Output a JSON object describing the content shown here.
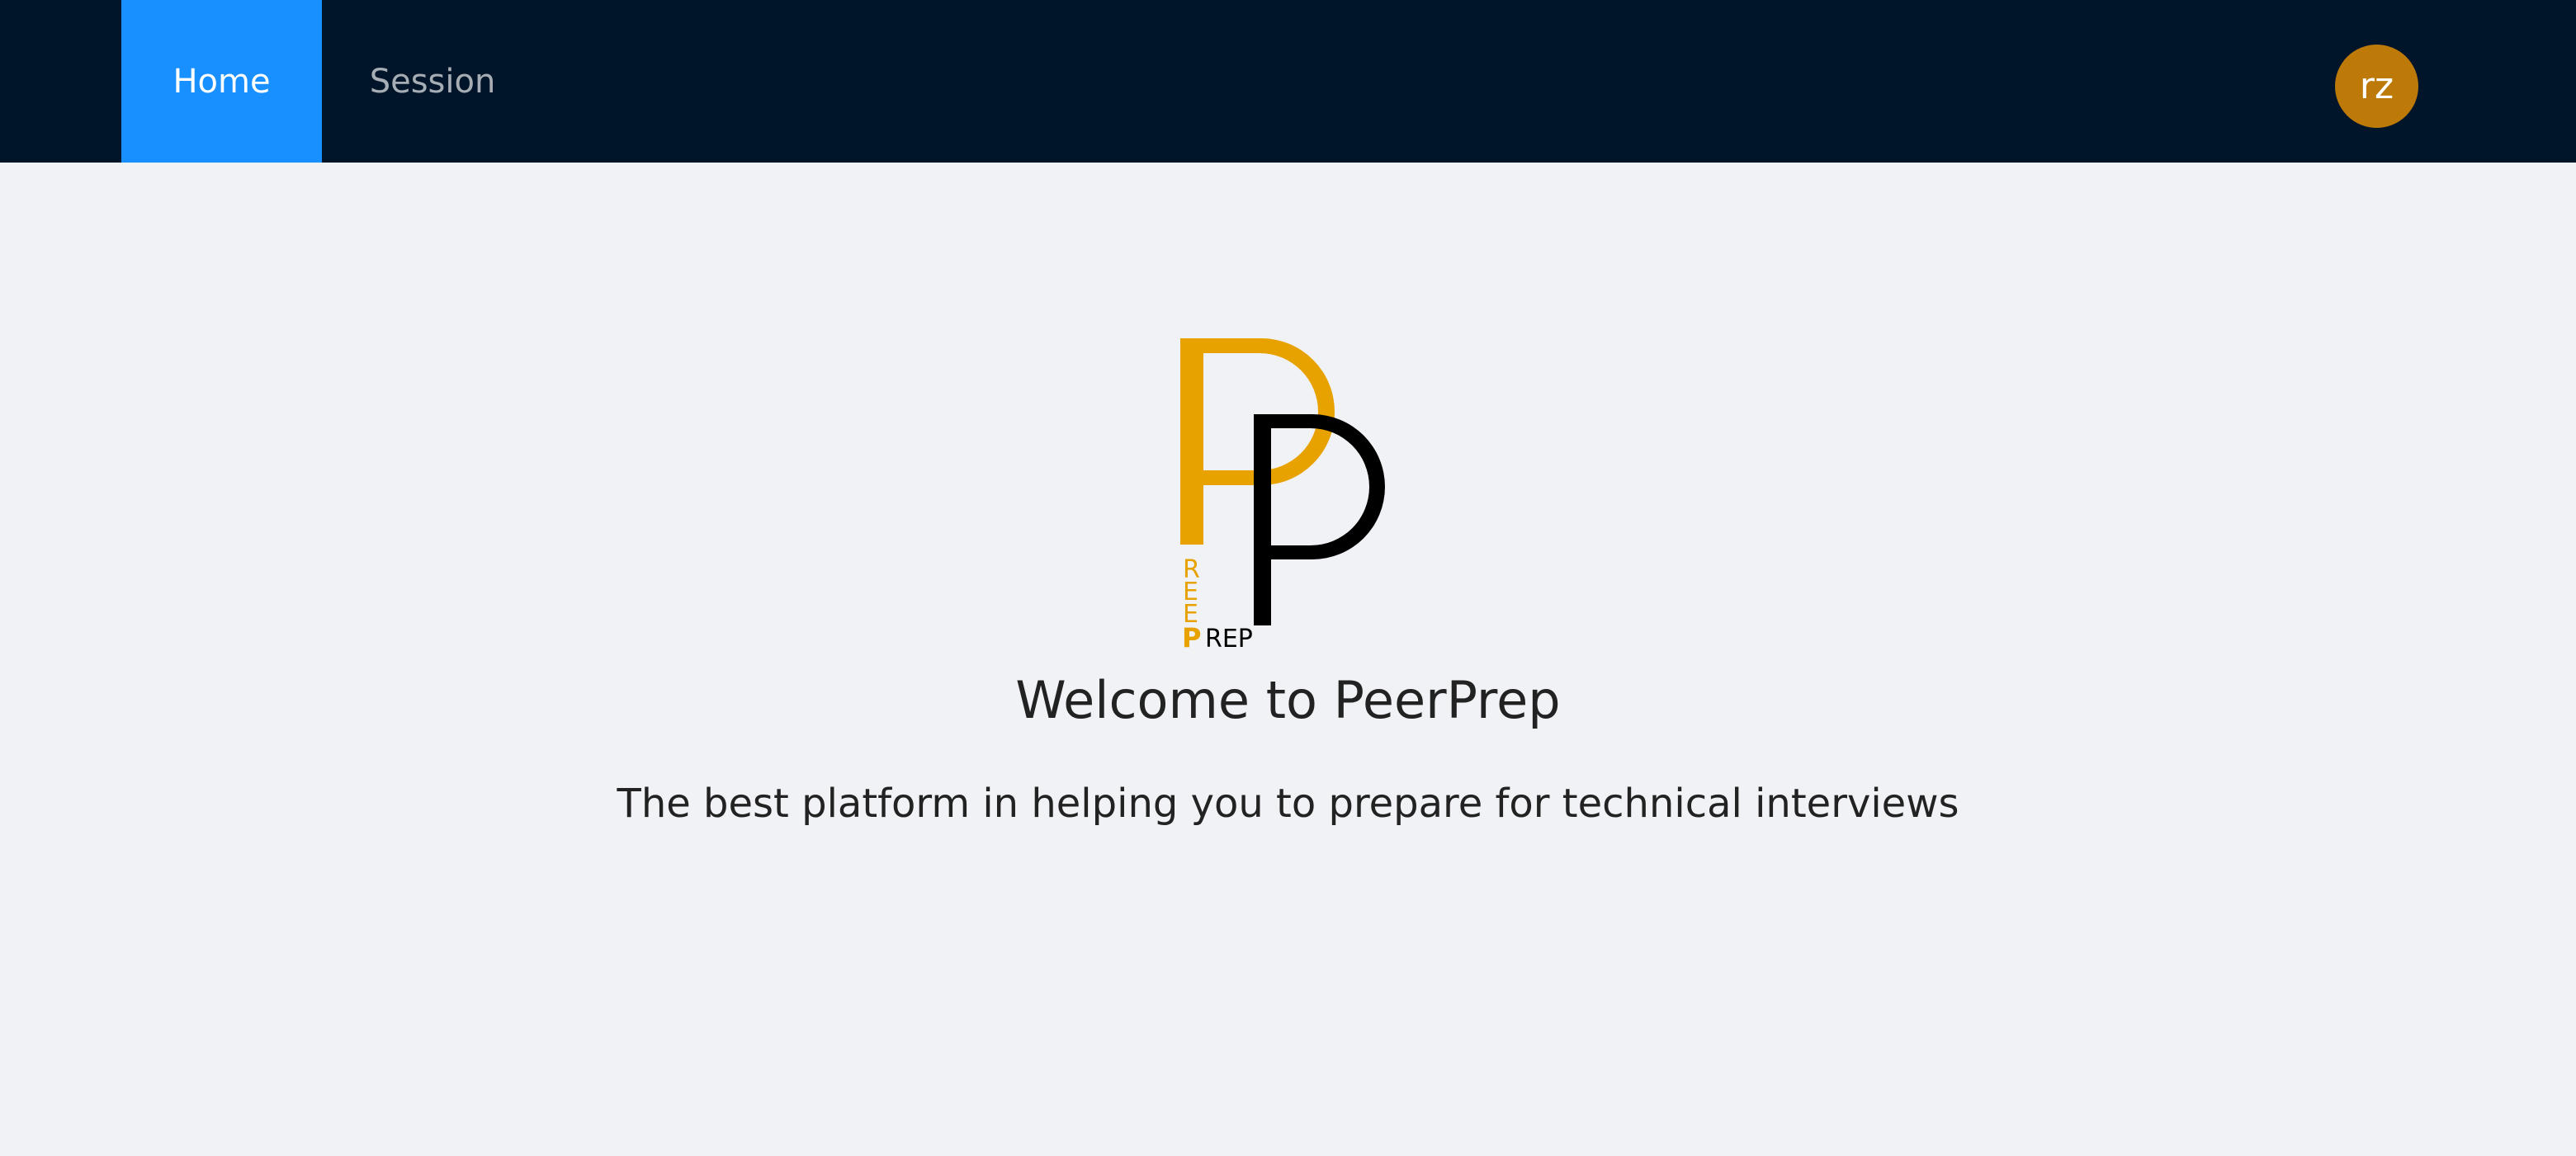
{
  "nav": {
    "items": [
      {
        "label": "Home",
        "active": true
      },
      {
        "label": "Session",
        "active": false
      }
    ]
  },
  "user": {
    "avatar_initials": "rz",
    "avatar_color": "#bd7a09"
  },
  "logo": {
    "vertical_letters": "REE",
    "bold_letter": "P",
    "small_word": "REP",
    "primary_color": "#e8a200",
    "secondary_color": "#000000"
  },
  "main": {
    "title": "Welcome to PeerPrep",
    "subtitle": "The best platform in helping you to prepare for technical interviews"
  },
  "colors": {
    "header_bg": "#001529",
    "active_tab": "#1890ff",
    "page_bg": "#f0f2f5"
  }
}
